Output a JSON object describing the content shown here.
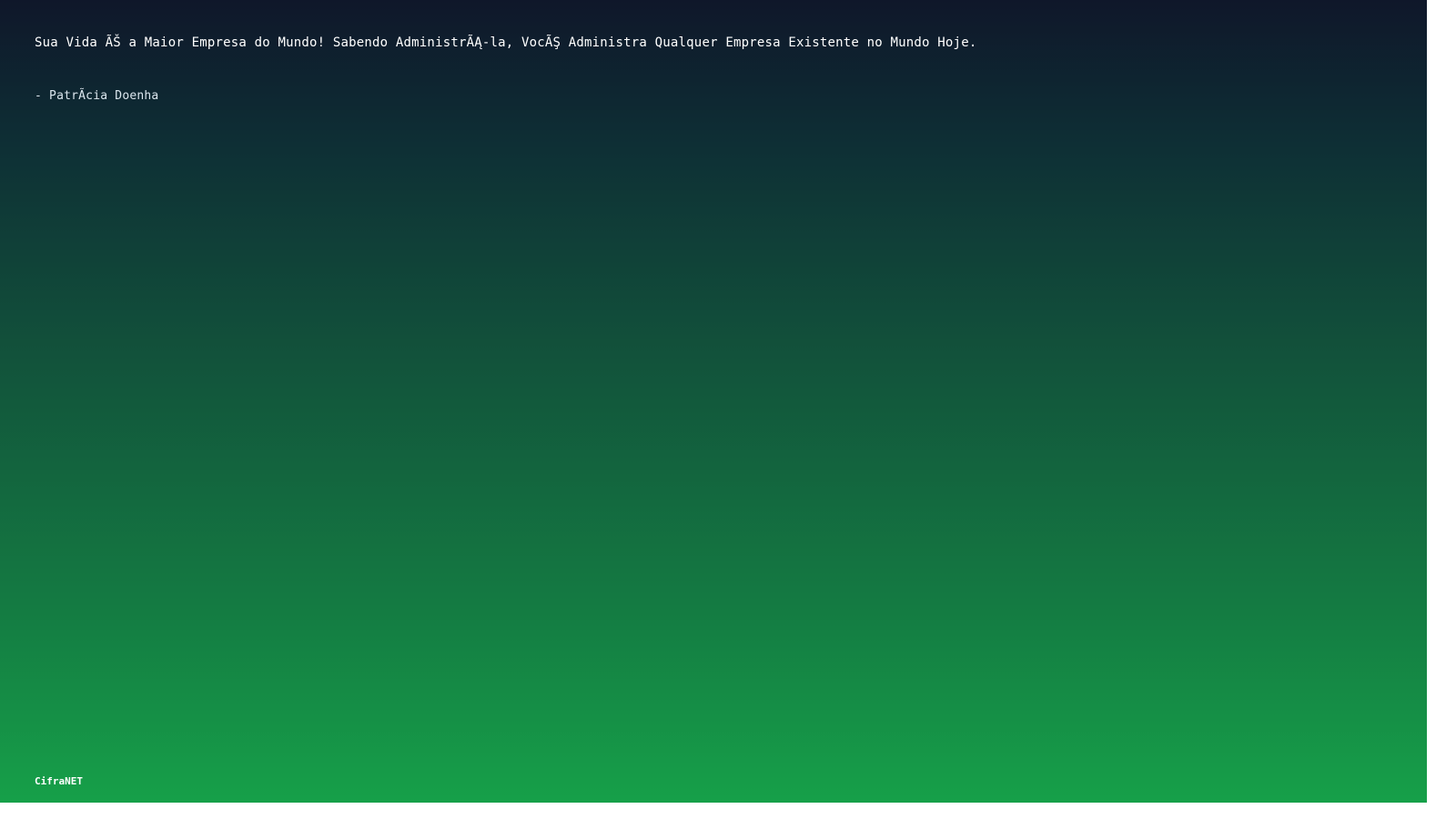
{
  "quote": {
    "text": "Sua Vida ÃŠ a Maior Empresa do Mundo! Sabendo AdministrÃĄ-la, VocÃŞ Administra Qualquer Empresa Existente no Mundo Hoje.",
    "author": "- PatrÃ­cia Doenha"
  },
  "footer": {
    "brand": "CifraNET"
  },
  "colors": {
    "background_top": "#0f172a",
    "background_bottom": "#16a049",
    "text": "#ffffff"
  }
}
